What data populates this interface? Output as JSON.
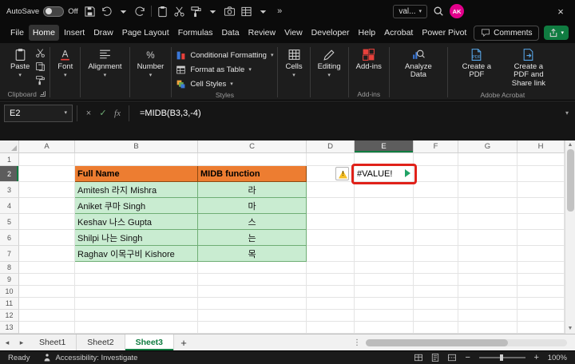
{
  "titlebar": {
    "autosave_label": "AutoSave",
    "autosave_state": "Off",
    "quick_icons": [
      "save",
      "undo",
      "chevron-down",
      "redo",
      "divider",
      "clipboard",
      "scissors",
      "brush",
      "chevron-down",
      "camera",
      "table",
      "chevron-down",
      "overflow"
    ],
    "search_text": "val...",
    "avatar_initials": "AK"
  },
  "menubar": {
    "tabs": [
      "File",
      "Home",
      "Insert",
      "Draw",
      "Page Layout",
      "Formulas",
      "Data",
      "Review",
      "View",
      "Developer",
      "Help",
      "Acrobat",
      "Power Pivot"
    ],
    "active_tab": "Home",
    "comments_label": "Comments"
  },
  "ribbon": {
    "paste": "Paste",
    "clipboard_group": "Clipboard",
    "font": "Font",
    "alignment": "Alignment",
    "number": "Number",
    "conditional_formatting": "Conditional Formatting",
    "format_as_table": "Format as Table",
    "cell_styles": "Cell Styles",
    "styles_group": "Styles",
    "cells": "Cells",
    "editing": "Editing",
    "add_ins": "Add-ins",
    "add_ins_group": "Add-ins",
    "analyze_data": "Analyze Data",
    "create_pdf": "Create a PDF",
    "create_pdf_share": "Create a PDF and Share link",
    "acrobat_group": "Adobe Acrobat"
  },
  "formula_bar": {
    "name_box": "E2",
    "cancel_glyph": "×",
    "enter_glyph": "✓",
    "insert_function_label": "fx",
    "formula": "=MIDB(B3,3,-4)"
  },
  "grid": {
    "columns": [
      "A",
      "B",
      "C",
      "D",
      "E",
      "F",
      "G",
      "H"
    ],
    "row_count": 13,
    "selected_cell": "E2",
    "selected_column": "E",
    "selected_row": 2,
    "cells": [
      {
        "ref": "B2",
        "text": "Full Name",
        "style": "orange"
      },
      {
        "ref": "C2",
        "text": "MIDB function",
        "style": "orange"
      },
      {
        "ref": "E2",
        "text": "#VALUE!",
        "style": "error"
      },
      {
        "ref": "B3",
        "text": "Amitesh 라지 Mishra",
        "style": "green"
      },
      {
        "ref": "C3",
        "text": "라",
        "style": "green center"
      },
      {
        "ref": "B4",
        "text": "Aniket 쿠마 Singh",
        "style": "green"
      },
      {
        "ref": "C4",
        "text": "마",
        "style": "green center"
      },
      {
        "ref": "B5",
        "text": "Keshav 나스 Gupta",
        "style": "green"
      },
      {
        "ref": "C5",
        "text": "스",
        "style": "green center"
      },
      {
        "ref": "B6",
        "text": "Shilpi 나는 Singh",
        "style": "green"
      },
      {
        "ref": "C6",
        "text": "는",
        "style": "green center"
      },
      {
        "ref": "B7",
        "text": "Raghav 이목구비 Kishore",
        "style": "green"
      },
      {
        "ref": "C7",
        "text": "목",
        "style": "green center"
      }
    ]
  },
  "sheet_tabs": {
    "tabs": [
      "Sheet1",
      "Sheet2",
      "Sheet3"
    ],
    "active_tab": "Sheet3",
    "add_label": "+"
  },
  "status_bar": {
    "ready": "Ready",
    "accessibility": "Accessibility: Investigate",
    "zoom": "100%"
  },
  "colors": {
    "table_header_fill": "#ED7D31",
    "table_data_fill": "#C9ECD1",
    "error_annotation": "#E0221A",
    "excel_green": "#107C41",
    "avatar": "#E3008C"
  }
}
